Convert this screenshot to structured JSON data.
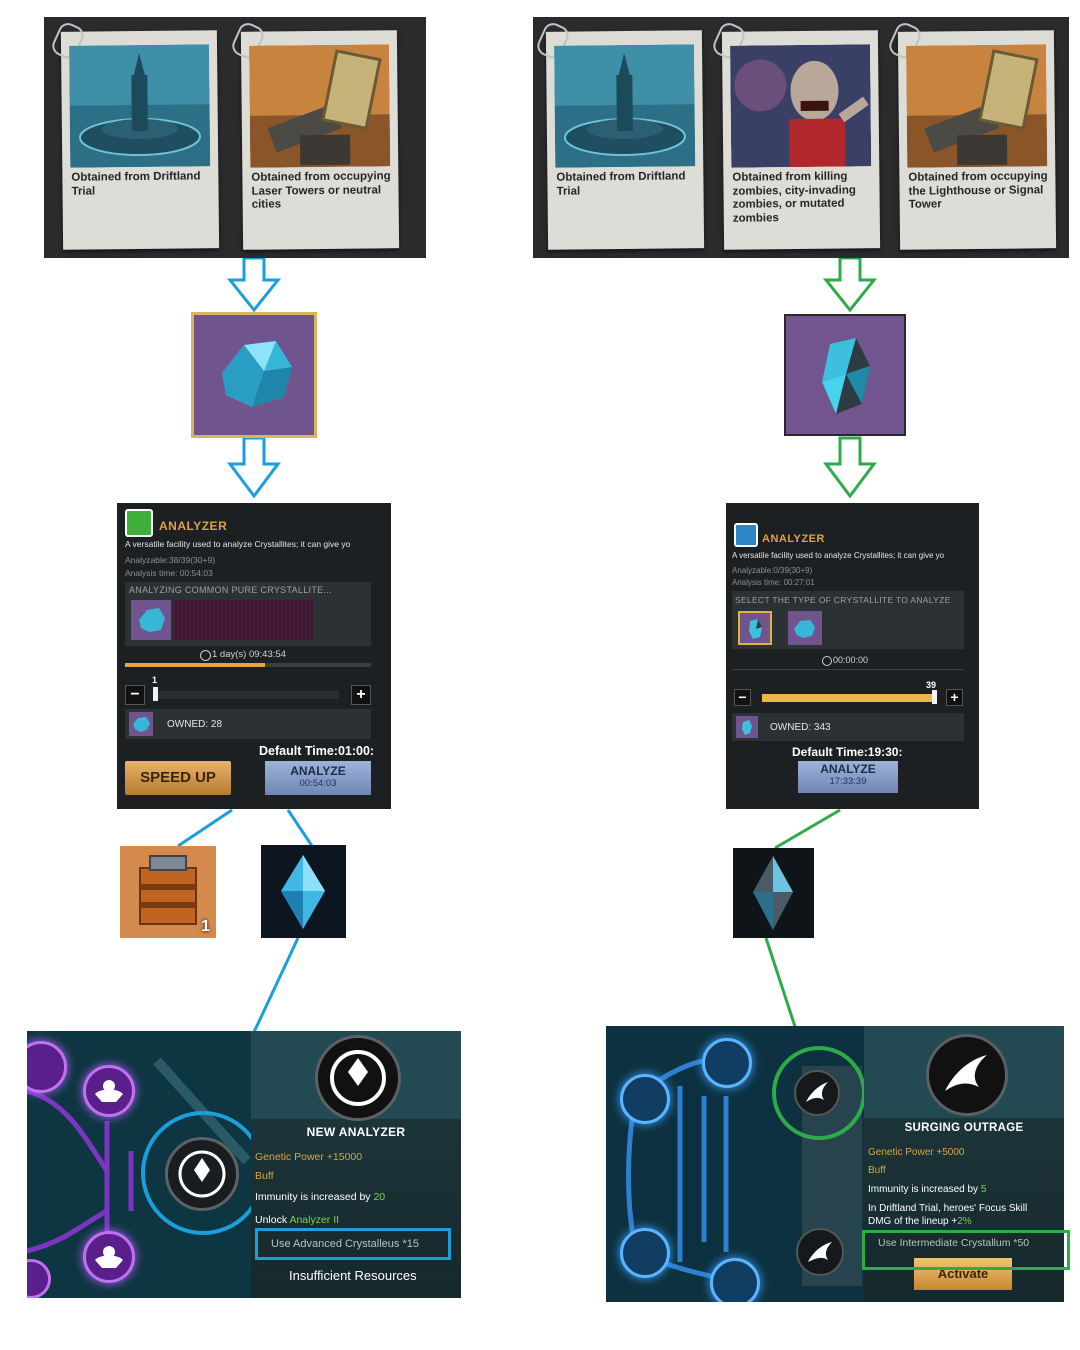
{
  "left": {
    "sources": [
      {
        "caption": "Obtained from Driftland Trial",
        "icon": "fountain-tower-image"
      },
      {
        "caption": "Obtained from occupying Laser Towers or neutral cities",
        "icon": "laser-tower-image"
      }
    ],
    "crystal_icon": "common-pure-crystallite-icon",
    "analyzer": {
      "title": "ANALYZER",
      "description": "A versatile facility used to analyze Crystallites; it can give yo",
      "analyzable": "Analyzable:38/39(30+9)",
      "analysis_time": "Analysis time: 00:54:03",
      "status": "ANALYZING COMMON PURE CRYSTALLITE...",
      "timer": "1 day(s) 09:43:54",
      "progress": 0.57,
      "slider_value": "1",
      "slider_fraction": 0.0,
      "owned": "OWNED: 28",
      "default_time": "Default Time:01:00:",
      "speed_up": "SPEED UP",
      "analyze": "ANALYZE",
      "analyze_time": "00:54:03"
    },
    "outputs": [
      {
        "icon": "orange-supply-crate-icon",
        "count": "1"
      },
      {
        "icon": "advanced-crystalleus-icon",
        "count": ""
      }
    ],
    "skill": {
      "name": "NEW ANALYZER",
      "stats": {
        "power": "Genetic Power +15000",
        "buff": "Buff",
        "immunity_text": "Immunity is increased by ",
        "immunity_value": "20",
        "unlock_text": "Unlock ",
        "unlock_value": "Analyzer  II"
      },
      "use": "Use Advanced Crystalleus *15",
      "status": "Insufficient Resources"
    },
    "accent": "#1a9fdc"
  },
  "right": {
    "sources": [
      {
        "caption": "Obtained from Driftland Trial",
        "icon": "fountain-tower-image"
      },
      {
        "caption": "Obtained from killing zombies, city-invading zombies, or mutated zombies",
        "icon": "zombie-image"
      },
      {
        "caption": "Obtained from occupying the Lighthouse or Signal Tower",
        "icon": "laser-tower-image"
      }
    ],
    "crystal_icon": "intermediate-crystallite-icon",
    "analyzer": {
      "title": "ANALYZER",
      "description": "A versatile facility used to analyze Crystallites; it can give yo",
      "analyzable": "Analyzable:0/39(30+9)",
      "analysis_time": "Analysis time: 00:27:01",
      "status": "SELECT THE TYPE OF CRYSTALLITE TO ANALYZE",
      "timer": "00:00:00",
      "slider_value": "39",
      "slider_fraction": 1.0,
      "owned": "OWNED: 343",
      "default_time": "Default Time:19:30:",
      "analyze": "ANALYZE",
      "analyze_time": "17:33:39"
    },
    "outputs": [
      {
        "icon": "intermediate-crystallum-icon",
        "count": ""
      }
    ],
    "skill": {
      "name": "SURGING OUTRAGE",
      "stats": {
        "power": "Genetic Power +5000",
        "buff": "Buff",
        "immunity_text": "Immunity is increased by ",
        "immunity_value": "5",
        "focus_line1": "In Driftland Trial, heroes' Focus Skill",
        "focus_line2a": "DMG of the lineup +",
        "focus_value": "2%"
      },
      "use": "Use Intermediate Crystallum *50",
      "activate": "Activate"
    },
    "accent": "#2eab49"
  }
}
